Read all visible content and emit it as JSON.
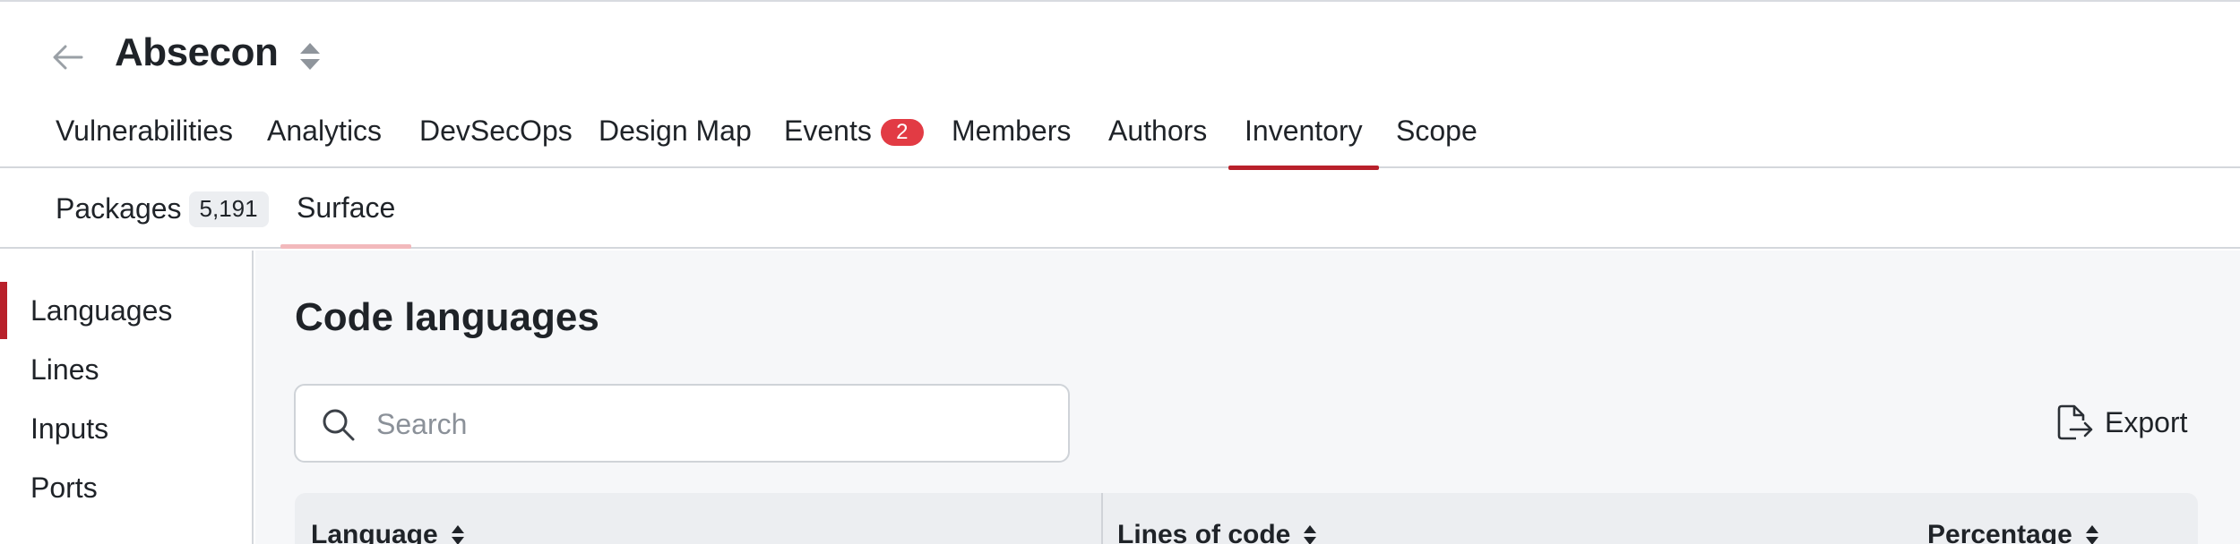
{
  "header": {
    "project_title": "Absecon"
  },
  "main_tabs": [
    {
      "label": "Vulnerabilities"
    },
    {
      "label": "Analytics"
    },
    {
      "label": "DevSecOps"
    },
    {
      "label": "Design Map"
    },
    {
      "label": "Events",
      "badge": "2"
    },
    {
      "label": "Members"
    },
    {
      "label": "Authors"
    },
    {
      "label": "Inventory",
      "active": true
    },
    {
      "label": "Scope"
    }
  ],
  "sub_tabs": [
    {
      "label": "Packages",
      "count": "5,191"
    },
    {
      "label": "Surface",
      "active": true
    }
  ],
  "sidebar": {
    "items": [
      {
        "label": "Languages",
        "active": true
      },
      {
        "label": "Lines"
      },
      {
        "label": "Inputs"
      },
      {
        "label": "Ports"
      }
    ]
  },
  "content": {
    "title": "Code languages",
    "search": {
      "placeholder": "Search",
      "value": ""
    },
    "export_label": "Export",
    "table": {
      "columns": [
        "Language",
        "Lines of code",
        "Percentage"
      ]
    }
  },
  "colors": {
    "accent": "#b8202a",
    "badge": "#e23b44",
    "sub_tab_underline": "#f2b9bc"
  },
  "icons": {
    "back": "arrow-left-icon",
    "switcher": "sort-updown-icon",
    "search": "search-icon",
    "export": "file-export-icon",
    "sort": "sort-icon"
  }
}
